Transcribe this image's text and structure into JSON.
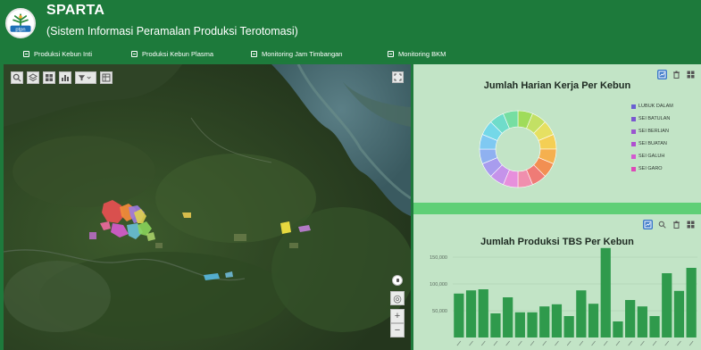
{
  "header": {
    "title": "SPARTA",
    "subtitle": "(Sistem Informasi Peramalan Produksi Terotomasi)",
    "logo_text": "ptpn"
  },
  "nav": {
    "items": [
      {
        "label": "Produksi Kebun Inti"
      },
      {
        "label": "Produksi Kebun Plasma"
      },
      {
        "label": "Monitoring Jam Timbangan"
      },
      {
        "label": "Monitoring BKM"
      }
    ]
  },
  "map": {
    "toolbar": [
      "search-icon",
      "layers-icon",
      "grid-icon",
      "chart-icon",
      "filter-icon",
      "table-icon"
    ],
    "zoom_in_label": "+",
    "zoom_out_label": "−"
  },
  "panels": {
    "donut": {
      "title": "Jumlah Harian Kerja Per Kebun",
      "legend": [
        {
          "label": "LUBUK DALAM",
          "color": "#6a5fd2"
        },
        {
          "label": "SEI BATULAN",
          "color": "#7a57d0"
        },
        {
          "label": "SEI BERLIAN",
          "color": "#9a55cf"
        },
        {
          "label": "SEI BUATAN",
          "color": "#b04fd0"
        },
        {
          "label": "SEI GALUH",
          "color": "#d25ad0"
        },
        {
          "label": "SEI GARO",
          "color": "#dd49b8"
        }
      ]
    },
    "bars": {
      "title": "Jumlah Produksi TBS Per Kebun"
    }
  },
  "chart_data": [
    {
      "type": "pie",
      "title": "Jumlah Harian Kerja Per Kebun",
      "labels": [
        "LUBUK DALAM",
        "SEI BATULAN",
        "SEI BERLIAN",
        "SEI BUATAN",
        "SEI GALUH",
        "SEI GARO"
      ],
      "colors": [
        "#9fdc5a",
        "#c3e064",
        "#e6e062",
        "#f4cf55",
        "#f5b04f",
        "#f28f52",
        "#ef7b76",
        "#f08fae",
        "#e78fdc",
        "#c593ea",
        "#a89cee",
        "#8fb1f0",
        "#7fc9f2",
        "#74d8e8",
        "#6fdcca",
        "#76dea2"
      ],
      "values": [
        1,
        1,
        1,
        1,
        1,
        1,
        1,
        1,
        1,
        1,
        1,
        1,
        1,
        1,
        1,
        1
      ]
    },
    {
      "type": "bar",
      "title": "Jumlah Produksi TBS Per Kebun",
      "ylim": [
        0,
        170000
      ],
      "yticks": [
        "150,000",
        "100,000",
        "50,000"
      ],
      "ytick_values": [
        150000,
        100000,
        50000
      ],
      "bar_color": "#2f9a4c",
      "values": [
        82000,
        88000,
        90000,
        45000,
        75000,
        47000,
        47000,
        58000,
        62000,
        40000,
        88000,
        63000,
        167000,
        30000,
        70000,
        58000,
        40000,
        120000,
        87000,
        130000
      ],
      "x_labels": [
        "A",
        "",
        "",
        "",
        "",
        "",
        "",
        "",
        "",
        "",
        "",
        "",
        "",
        "",
        "",
        "",
        "",
        "",
        "",
        ""
      ]
    }
  ]
}
